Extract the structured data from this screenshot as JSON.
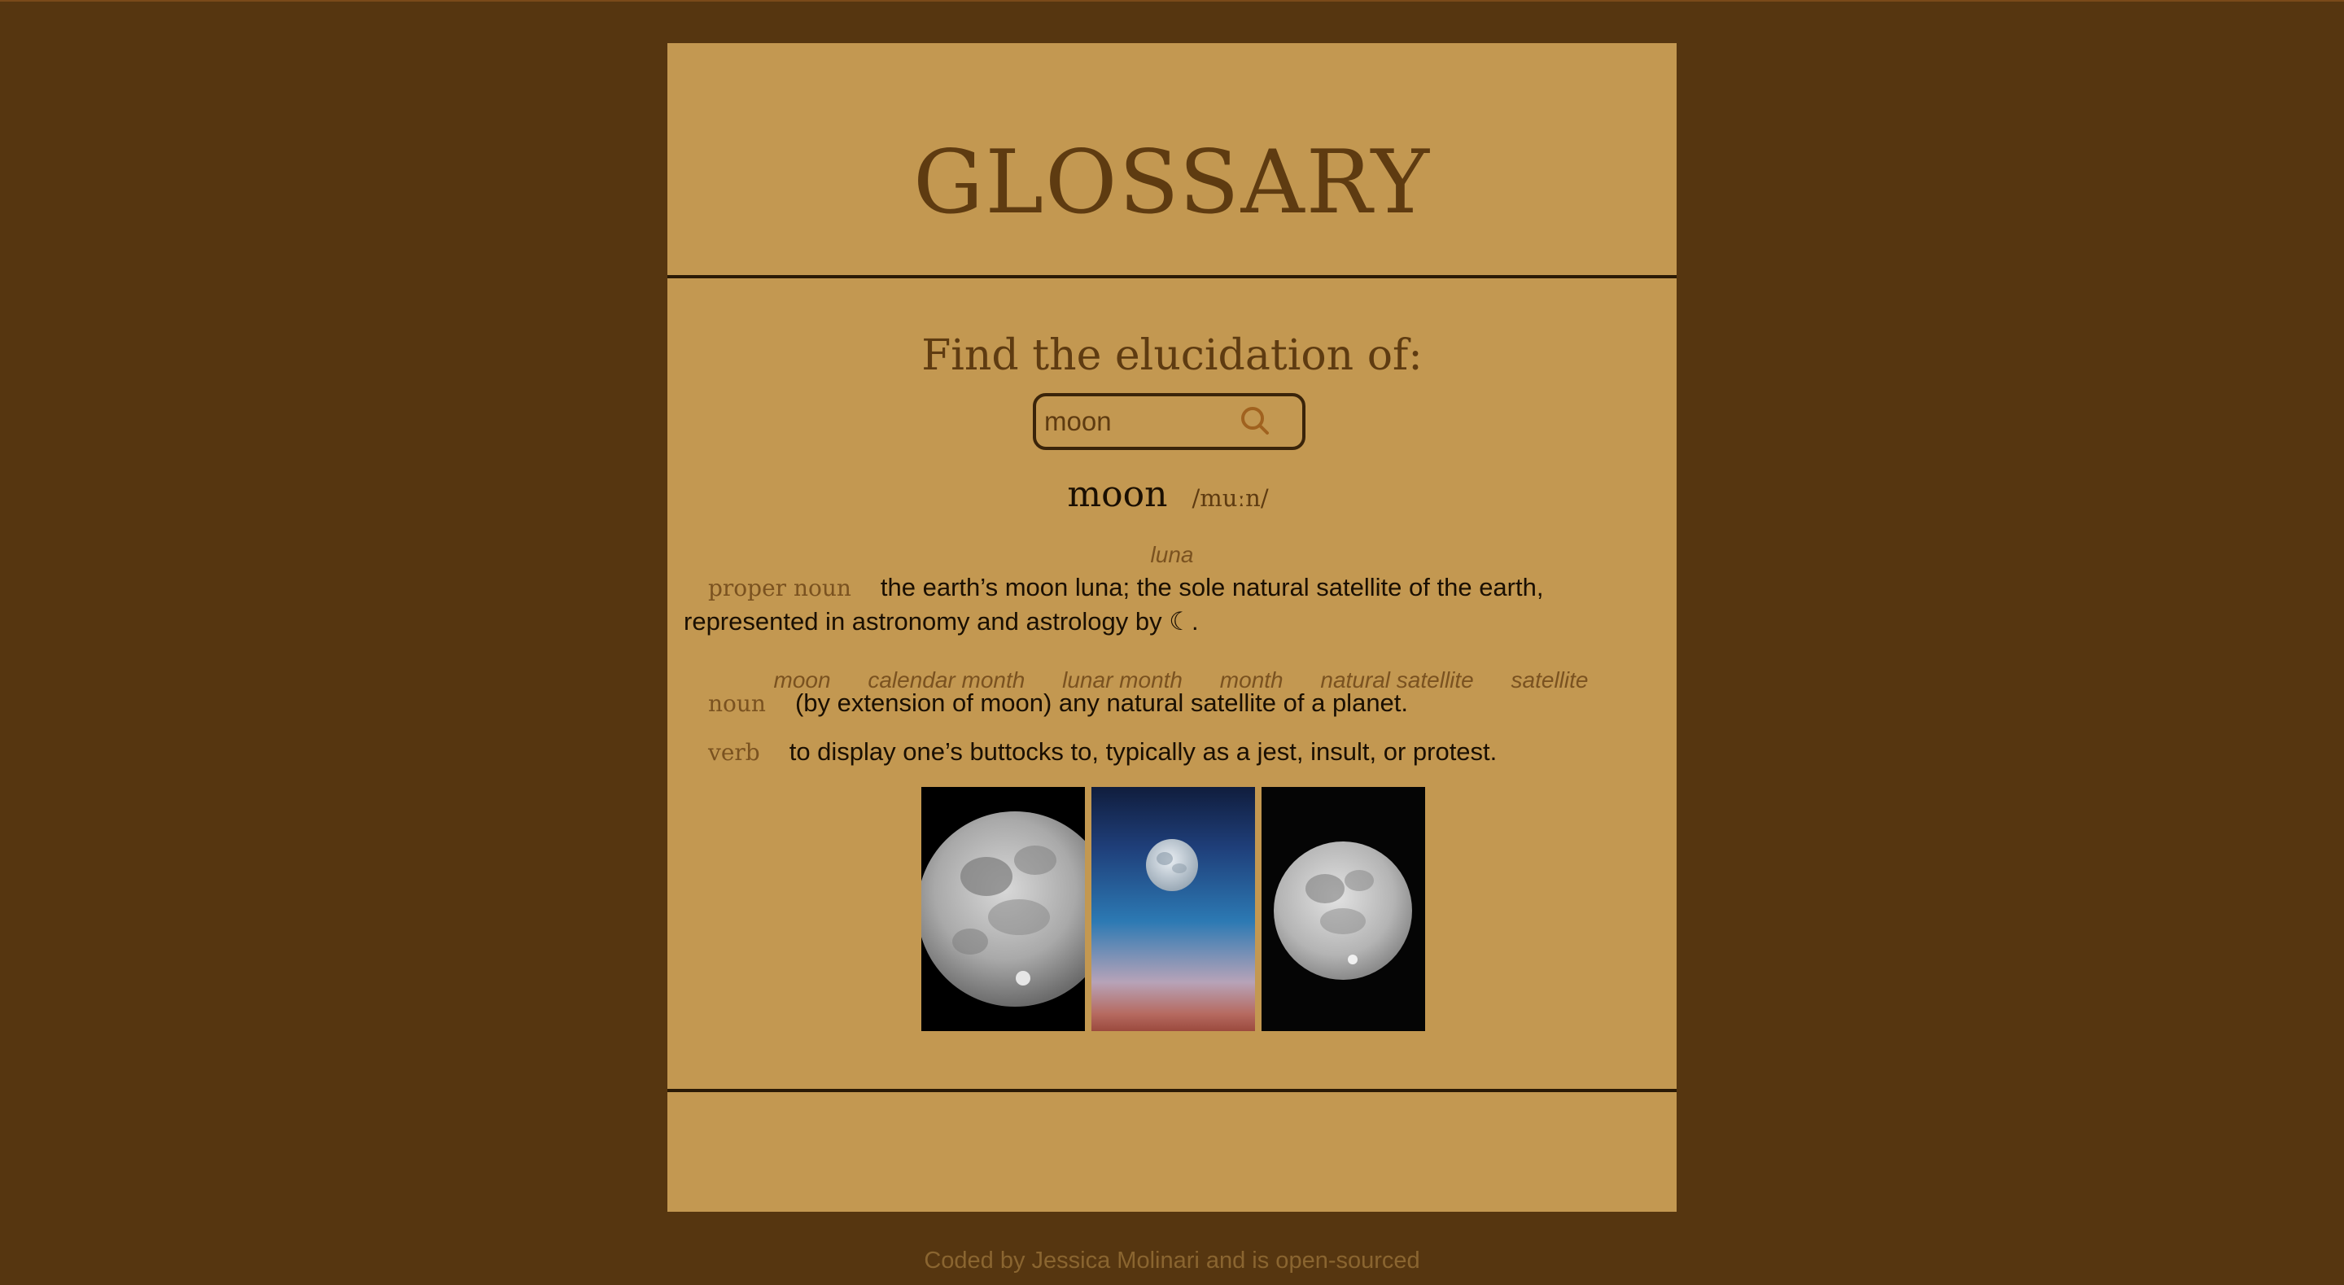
{
  "header": {
    "title": "GLOSSARY"
  },
  "search": {
    "heading": "Find the elucidation of:",
    "value": "moon"
  },
  "entry": {
    "word": "moon",
    "phonetic": "/muːn/",
    "meanings": [
      {
        "synonyms": [
          "luna"
        ],
        "part_of_speech": "proper noun",
        "definition": "the earth’s moon luna; the sole natural satellite of the earth, represented in astronomy and astrology by ☾."
      },
      {
        "synonyms": [
          "moon",
          "calendar month",
          "lunar month",
          "month",
          "natural satellite",
          "satellite"
        ],
        "part_of_speech": "noun",
        "definition": "(by extension of moon) any natural satellite of a planet."
      },
      {
        "synonyms": [],
        "part_of_speech": "verb",
        "definition": "to display one’s buttocks to, typically as a jest, insult, or protest."
      }
    ]
  },
  "images": [
    {
      "label": "moon-photo-1"
    },
    {
      "label": "moon-photo-2"
    },
    {
      "label": "moon-photo-3"
    }
  ],
  "footer": {
    "credit": "Coded by Jessica Molinari and is open-sourced"
  },
  "colors": {
    "page_bg": "#563610",
    "card_bg": "#c39851",
    "title": "#5e3b11",
    "divider": "#2a1a06",
    "accent": "#a0621f"
  }
}
